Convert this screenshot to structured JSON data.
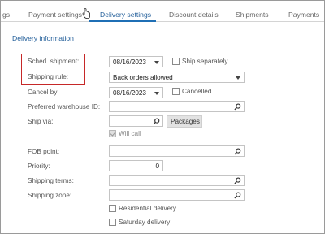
{
  "tabs": [
    {
      "label": "gs"
    },
    {
      "label": "Payment settings"
    },
    {
      "label": "Delivery settings",
      "active": true
    },
    {
      "label": "Discount details"
    },
    {
      "label": "Shipments"
    },
    {
      "label": "Payments"
    }
  ],
  "section_title": "Delivery information",
  "fields": {
    "sched_shipment": {
      "label": "Sched. shipment:",
      "value": "08/16/2023"
    },
    "ship_separately": {
      "label": "Ship separately",
      "checked": false
    },
    "shipping_rule": {
      "label": "Shipping rule:",
      "value": "Back orders allowed"
    },
    "cancel_by": {
      "label": "Cancel by:",
      "value": "08/16/2023"
    },
    "cancelled": {
      "label": "Cancelled",
      "checked": false
    },
    "preferred_warehouse": {
      "label": "Preferred warehouse ID:",
      "value": ""
    },
    "ship_via": {
      "label": "Ship via:",
      "value": ""
    },
    "packages_button": {
      "label": "Packages"
    },
    "will_call": {
      "label": "Will call",
      "checked": true,
      "disabled": true
    },
    "fob_point": {
      "label": "FOB point:",
      "value": ""
    },
    "priority": {
      "label": "Priority:",
      "value": "0"
    },
    "shipping_terms": {
      "label": "Shipping terms:",
      "value": ""
    },
    "shipping_zone": {
      "label": "Shipping zone:",
      "value": ""
    },
    "residential_delivery": {
      "label": "Residential delivery",
      "checked": false
    },
    "saturday_delivery": {
      "label": "Saturday delivery",
      "checked": false
    }
  },
  "colors": {
    "accent": "#1f6fb5",
    "highlight_box": "#c62828"
  }
}
